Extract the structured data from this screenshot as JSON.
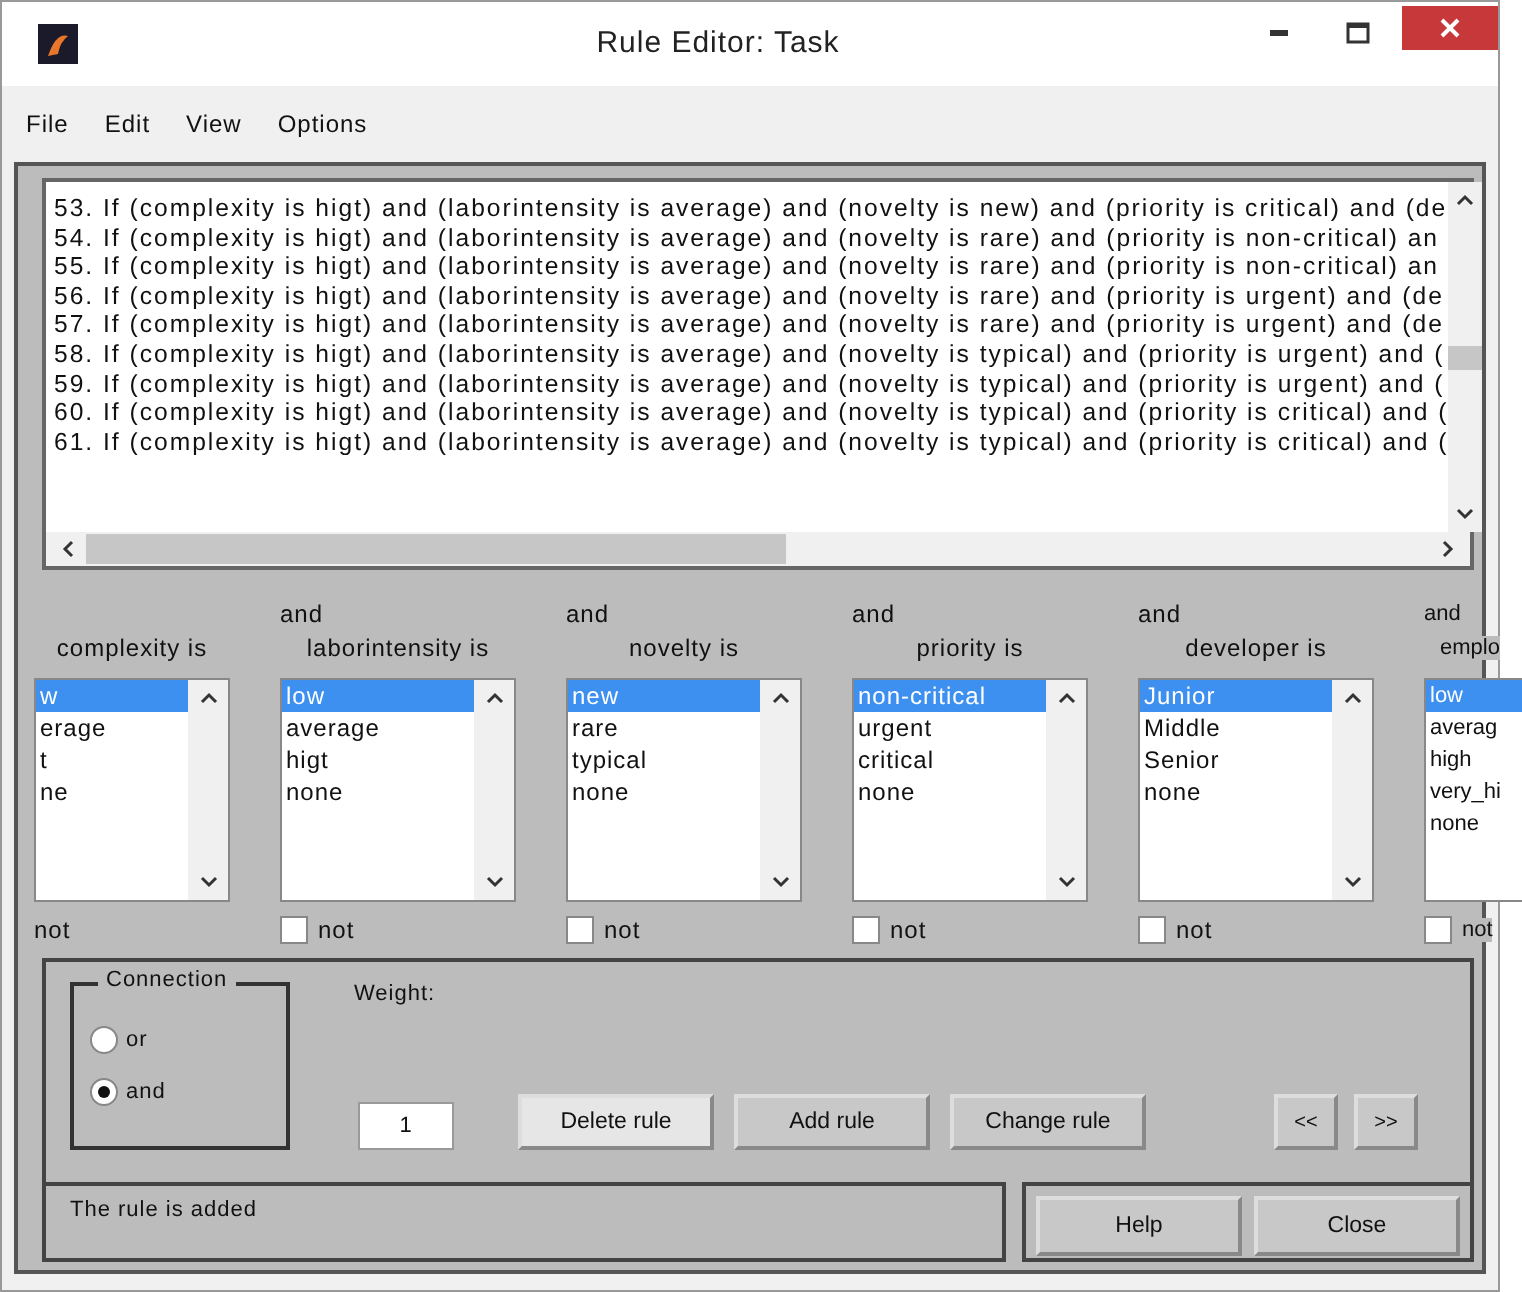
{
  "window": {
    "title": "Rule Editor: Task"
  },
  "menu": [
    "File",
    "Edit",
    "View",
    "Options"
  ],
  "rules": [
    "53. If (complexity is higt) and (laborintensity is average) and (novelty is new) and (priority is critical) and (de",
    "54. If (complexity is higt) and (laborintensity is average) and (novelty is rare) and (priority is non-critical) an",
    "55. If (complexity is higt) and (laborintensity is average) and (novelty is rare) and (priority is non-critical) an",
    "56. If (complexity is higt) and (laborintensity is average) and (novelty is rare) and (priority is urgent) and (de",
    "57. If (complexity is higt) and (laborintensity is average) and (novelty is rare) and (priority is urgent) and (de",
    "58. If (complexity is higt) and (laborintensity is average) and (novelty is typical) and (priority is urgent) and (",
    "59. If (complexity is higt) and (laborintensity is average) and (novelty is typical) and (priority is urgent) and (",
    "60. If (complexity is higt) and (laborintensity is average) and (novelty is typical) and (priority is critical) and (",
    "61. If (complexity is higt) and (laborintensity is average) and (novelty is typical) and (priority is critical) and ("
  ],
  "conditions": [
    {
      "kind": "cut",
      "label": "complexity is",
      "items": [
        {
          "text": "w",
          "selected": true
        },
        {
          "text": "erage",
          "selected": false
        },
        {
          "text": "t",
          "selected": false
        },
        {
          "text": "ne",
          "selected": false
        }
      ],
      "not_label": "not"
    },
    {
      "kind": "full",
      "connector": "and",
      "label": "laborintensity is",
      "items": [
        {
          "text": "low",
          "selected": true
        },
        {
          "text": "average",
          "selected": false
        },
        {
          "text": "higt",
          "selected": false
        },
        {
          "text": "none",
          "selected": false
        }
      ],
      "not_label": "not",
      "checked": false
    },
    {
      "kind": "full",
      "connector": "and",
      "label": "novelty is",
      "items": [
        {
          "text": "new",
          "selected": true
        },
        {
          "text": "rare",
          "selected": false
        },
        {
          "text": "typical",
          "selected": false
        },
        {
          "text": "none",
          "selected": false
        }
      ],
      "not_label": "not",
      "checked": false
    },
    {
      "kind": "full",
      "connector": "and",
      "label": "priority is",
      "items": [
        {
          "text": "non-critical",
          "selected": true
        },
        {
          "text": "urgent",
          "selected": false
        },
        {
          "text": "critical",
          "selected": false
        },
        {
          "text": "none",
          "selected": false
        }
      ],
      "not_label": "not",
      "checked": false
    },
    {
      "kind": "full",
      "connector": "and",
      "label": "developer is",
      "items": [
        {
          "text": "Junior",
          "selected": true
        },
        {
          "text": "Middle",
          "selected": false
        },
        {
          "text": "Senior",
          "selected": false
        },
        {
          "text": "none",
          "selected": false
        }
      ],
      "not_label": "not",
      "checked": false
    },
    {
      "kind": "edge",
      "connector": "and",
      "label": "emplo",
      "items": [
        {
          "text": "low",
          "selected": true
        },
        {
          "text": "averag",
          "selected": false
        },
        {
          "text": "high",
          "selected": false
        },
        {
          "text": "very_hi",
          "selected": false
        },
        {
          "text": "none",
          "selected": false
        }
      ],
      "not_label": "not",
      "checked": false
    }
  ],
  "connection": {
    "label": "Connection",
    "options": [
      {
        "label": "or",
        "selected": false
      },
      {
        "label": "and",
        "selected": true
      }
    ]
  },
  "weight": {
    "label": "Weight:",
    "value": "1"
  },
  "rule_buttons": [
    "Delete rule",
    "Add rule",
    "Change rule"
  ],
  "nav_buttons": [
    "<<",
    ">>"
  ],
  "status": "The rule is added",
  "dialog_buttons": [
    "Help",
    "Close"
  ]
}
